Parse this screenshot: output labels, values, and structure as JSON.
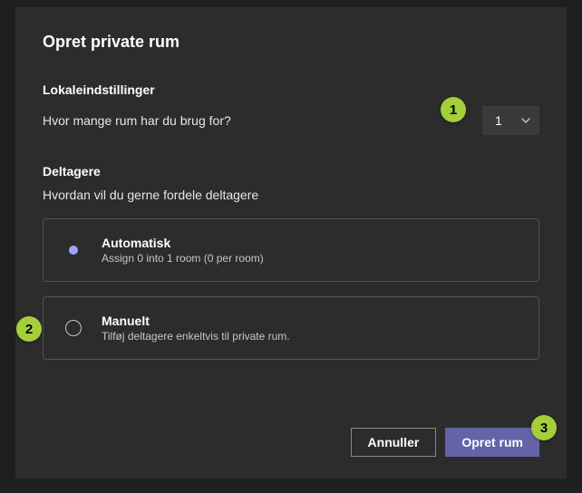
{
  "dialog": {
    "title": "Opret private rum",
    "room_settings": {
      "label": "Lokaleindstillinger",
      "prompt": "Hvor mange rum har du brug for?",
      "count_value": "1"
    },
    "participants": {
      "label": "Deltagere",
      "prompt": "Hvordan vil du gerne fordele deltagere"
    },
    "options": {
      "auto": {
        "title": "Automatisk",
        "subtitle": "Assign 0 into 1 room (0 per room)"
      },
      "manual": {
        "title": "Manuelt",
        "subtitle": "Tilføj deltagere enkeltvis til private rum."
      }
    },
    "buttons": {
      "cancel": "Annuller",
      "create": "Opret rum"
    }
  },
  "annotations": {
    "b1": "1",
    "b2": "2",
    "b3": "3"
  },
  "colors": {
    "primary": "#6264a7",
    "badge": "#a4cf3b",
    "radio_dot": "#9ea2ff"
  }
}
